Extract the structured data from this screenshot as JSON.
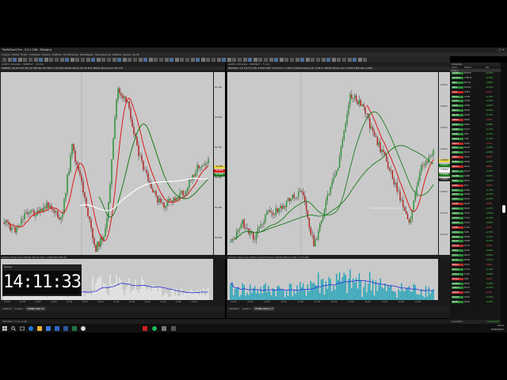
{
  "window": {
    "title": "ProfitChart Pro - 5.0.1.168 - Nelogica"
  },
  "menu": [
    "Arquivo",
    "Editar",
    "Exibir",
    "Cotações",
    "Ordens",
    "Gráficos",
    "Ferramentas",
    "Estratégias",
    "Tape Reading",
    "Sistema",
    "Janela",
    "Ajuda"
  ],
  "left_panel": {
    "window_label": "Gráfico Intraday - WINM17 - 15 min",
    "price_header": "WINM17 Ab 62.415 Mx 62.980 Mn 62.365 Fc 62.870  Média Móvel (9) 62.871  Média Móvel (21) 62.770",
    "indicator_header": "Volume Financeiro  Média Móvel (20) 1.248.901.268,00",
    "price_ticks": [
      "63.250",
      "63.000",
      "62.750",
      "62.500",
      "62.250",
      "62.000"
    ],
    "price_tags": [
      "62.895",
      "62.870",
      "62.850"
    ],
    "time_ticks": [
      "10:00",
      "11:00",
      "12:00",
      "13:00",
      "14:00",
      "15:00",
      "16:00",
      "17:00",
      "10:00",
      "11:00",
      "12:00",
      "13:00",
      "14:00"
    ],
    "tabs": [
      "WINM17",
      "Gráfico",
      "TIMBR WIN 15"
    ]
  },
  "right_panel": {
    "window_label": "Gráfico Intraday - WDON17 - 5 min",
    "price_header": "WDON17 Ab 3.277,5 Mx 3.290,0 Mn 3.270,5 Fc 3.287,5  Média Móvel (9) 3.287,1  Média Móvel (21) 3.283,9  Bandas 3.289",
    "indicator_header": "Volume Financeiro (Bars Quant./Divers)  Média Móvel (20) 1.371.482",
    "price_ticks": [
      "3.305,0",
      "3.300,0",
      "3.295,0",
      "3.290,0",
      "3.285,0",
      "3.280,0",
      "3.275,0",
      "3.270,0"
    ],
    "price_tags": [
      "3.288,0",
      "3.287,5",
      "3.286,0",
      "3.283,0",
      "3.280,5"
    ],
    "time_ticks": [
      "10:00",
      "11:00",
      "12:00",
      "13:00",
      "14:00",
      "15:00",
      "16:00",
      "17:00",
      "10:00",
      "11:00",
      "12:00",
      "13:00"
    ],
    "tabs": [
      "WDON17",
      "Gráfico",
      "TIMBR WDO 5 F"
    ]
  },
  "clock": {
    "label": "Relógio",
    "time": "14:11:33"
  },
  "sidebar": {
    "title": "Cotações",
    "columns": [
      "Ativo",
      "Último",
      "Var."
    ],
    "section_a": "Índice",
    "section_b": "Ações",
    "quotes": [
      {
        "sym": "WINM17",
        "last": "62.870",
        "chg": "+0,73%",
        "color": "#2e8b3a"
      },
      {
        "sym": "WDON17",
        "last": "3.287,5",
        "chg": "+0,30%",
        "color": "#2e8b3a"
      },
      {
        "sym": "IBOV",
        "last": "62.711",
        "chg": "+0,82%",
        "color": "#2e8b3a"
      },
      {
        "sym": "IND$",
        "last": "62.870",
        "chg": "+0,73%",
        "color": "#2e8b3a"
      },
      {
        "sym": "DOLF",
        "last": "3.287",
        "chg": "-0,12%",
        "color": "#c02a2a"
      },
      {
        "sym": "PETR4",
        "last": "13,08",
        "chg": "+1,40%",
        "color": "#2e8b3a"
      },
      {
        "sym": "VALE5",
        "last": "27,48",
        "chg": "+2,04%",
        "color": "#2e8b3a"
      },
      {
        "sym": "ITUB4",
        "last": "37,90",
        "chg": "+0,66%",
        "color": "#2e8b3a"
      },
      {
        "sym": "BBDC4",
        "last": "30,36",
        "chg": "+0,53%",
        "color": "#2e8b3a"
      },
      {
        "sym": "BBAS3",
        "last": "31,20",
        "chg": "+1,07%",
        "color": "#2e8b3a"
      },
      {
        "sym": "ABEV3",
        "last": "18,60",
        "chg": "-0,32%",
        "color": "#c02a2a"
      },
      {
        "sym": "BVMF3",
        "last": "22,84",
        "chg": "+0,88%",
        "color": "#2e8b3a"
      },
      {
        "sym": "GGBR4",
        "last": "10,12",
        "chg": "+1,91%",
        "color": "#2e8b3a"
      },
      {
        "sym": "USIM5",
        "last": "4,55",
        "chg": "+2,25%",
        "color": "#2e8b3a"
      },
      {
        "sym": "CSNA3",
        "last": "7,66",
        "chg": "+1,19%",
        "color": "#2e8b3a"
      },
      {
        "sym": "KROT3",
        "last": "14,95",
        "chg": "-0,27%",
        "color": "#c02a2a"
      },
      {
        "sym": "CIEL3",
        "last": "26,40",
        "chg": "+0,42%",
        "color": "#2e8b3a"
      },
      {
        "sym": "LREN3",
        "last": "30,72",
        "chg": "+0,98%",
        "color": "#2e8b3a"
      },
      {
        "sym": "RENT3",
        "last": "33,21",
        "chg": "-0,45%",
        "color": "#c02a2a"
      },
      {
        "sym": "EMBR3",
        "last": "16,05",
        "chg": "+0,31%",
        "color": "#2e8b3a"
      },
      {
        "sym": "BRFS3",
        "last": "40,10",
        "chg": "-0,84%",
        "color": "#c02a2a"
      },
      {
        "sym": "JBSS3",
        "last": "10,37",
        "chg": "+0,58%",
        "color": "#2e8b3a"
      },
      {
        "sym": "SUZB5",
        "last": "12,80",
        "chg": "+0,23%",
        "color": "#2e8b3a"
      },
      {
        "sym": "FIBR3",
        "last": "28,14",
        "chg": "+0,61%",
        "color": "#2e8b3a"
      },
      {
        "sym": "CMIG4",
        "last": "8,71",
        "chg": "-0,57%",
        "color": "#c02a2a"
      },
      {
        "sym": "ELET3",
        "last": "15,62",
        "chg": "+1,76%",
        "color": "#2e8b3a"
      },
      {
        "sym": "SBSP3",
        "last": "33,90",
        "chg": "+0,12%",
        "color": "#2e8b3a"
      },
      {
        "sym": "CPFE3",
        "last": "25,76",
        "chg": "+0,39%",
        "color": "#2e8b3a"
      },
      {
        "sym": "HYPE3",
        "last": "30,05",
        "chg": "-0,20%",
        "color": "#c02a2a"
      },
      {
        "sym": "RADL3",
        "last": "64,40",
        "chg": "+0,70%",
        "color": "#2e8b3a"
      },
      {
        "sym": "UGPA3",
        "last": "72,51",
        "chg": "+0,26%",
        "color": "#2e8b3a"
      },
      {
        "sym": "CCRO3",
        "last": "17,22",
        "chg": "+1,30%",
        "color": "#2e8b3a"
      },
      {
        "sym": "MRVE3",
        "last": "14,18",
        "chg": "+0,85%",
        "color": "#2e8b3a"
      },
      {
        "sym": "CYRE3",
        "last": "11,02",
        "chg": "-0,63%",
        "color": "#c02a2a"
      },
      {
        "sym": "GOAU4",
        "last": "5,29",
        "chg": "+2,32%",
        "color": "#2e8b3a"
      },
      {
        "sym": "BRKM5",
        "last": "34,60",
        "chg": "+0,44%",
        "color": "#2e8b3a"
      },
      {
        "sym": "MULT3",
        "last": "70,80",
        "chg": "+0,17%",
        "color": "#2e8b3a"
      },
      {
        "sym": "NATU3",
        "last": "27,33",
        "chg": "-0,51%",
        "color": "#c02a2a"
      },
      {
        "sym": "TIMP3",
        "last": "10,05",
        "chg": "+0,60%",
        "color": "#2e8b3a"
      },
      {
        "sym": "VIVT4",
        "last": "46,19",
        "chg": "+0,09%",
        "color": "#2e8b3a"
      },
      {
        "sym": "EQTL3",
        "last": "60,90",
        "chg": "+0,33%",
        "color": "#2e8b3a"
      },
      {
        "sym": "BRML3",
        "last": "12,41",
        "chg": "-0,40%",
        "color": "#c02a2a"
      },
      {
        "sym": "ESTC3",
        "last": "17,35",
        "chg": "+1,05%",
        "color": "#2e8b3a"
      },
      {
        "sym": "QUAL3",
        "last": "17,87",
        "chg": "+0,68%",
        "color": "#2e8b3a"
      },
      {
        "sym": "ECOR3",
        "last": "9,81",
        "chg": "-0,10%",
        "color": "#c02a2a"
      },
      {
        "sym": "SANB11",
        "last": "28,52",
        "chg": "+0,49%",
        "color": "#2e8b3a"
      },
      {
        "sym": "TAEE11",
        "last": "20,75",
        "chg": "+0,19%",
        "color": "#2e8b3a"
      },
      {
        "sym": "ENBR3",
        "last": "14,20",
        "chg": "-0,35%",
        "color": "#c02a2a"
      },
      {
        "sym": "MGLU3",
        "last": "22,10",
        "chg": "+3,12%",
        "color": "#2e8b3a"
      },
      {
        "sym": "BBSE3",
        "last": "28,40",
        "chg": "+0,25%",
        "color": "#2e8b3a"
      }
    ],
    "footer_left": "Conectado",
    "footer_right": "Tempo Real"
  },
  "statusbar": {
    "text": "WDON17 5 min   0,00"
  },
  "taskbar": {
    "time": "14:11",
    "date": "15/05/2017"
  },
  "colors": {
    "bull": "#1f8f2a",
    "bear": "#b01818",
    "ma_fast": "#d81c1c",
    "ma_slow": "#1c7a1c",
    "ma_long": "#ffffff",
    "chart_bg": "#c9c9c9",
    "volume_left": "#f0f0f0",
    "volume_right": "#1aa3b8",
    "volume_ma": "#2b2bd8"
  }
}
